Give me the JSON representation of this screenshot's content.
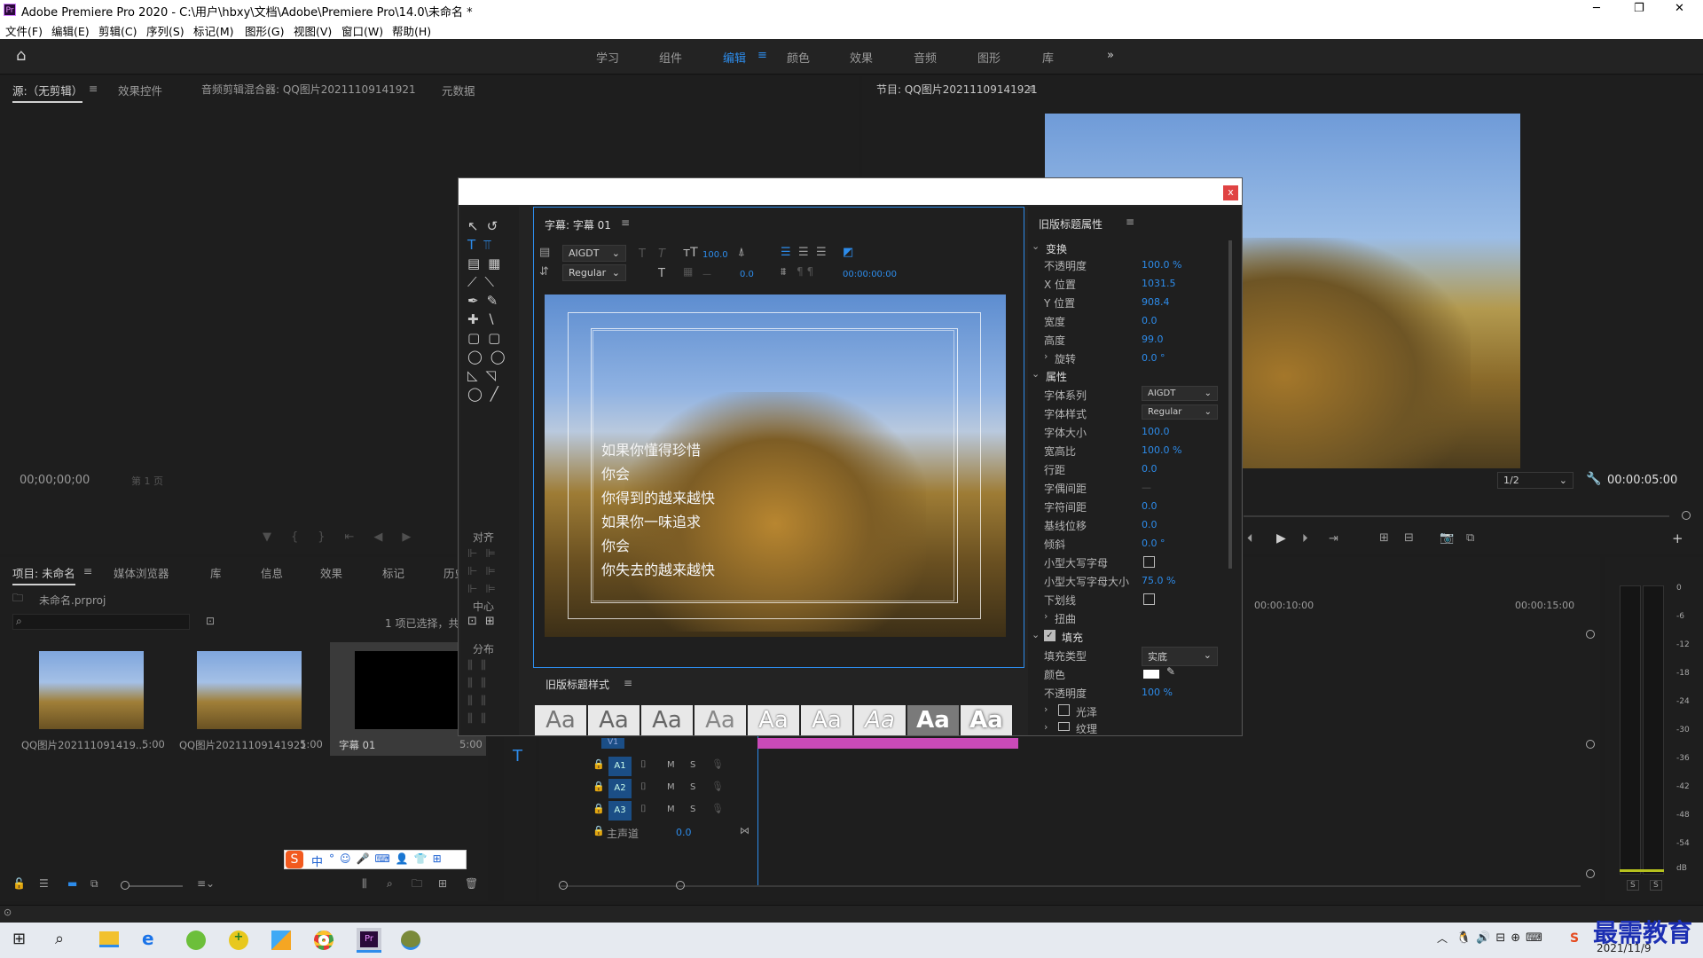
{
  "window": {
    "title": "Adobe Premiere Pro 2020 - C:\\用户\\hbxy\\文档\\Adobe\\Premiere Pro\\14.0\\未命名 *",
    "minimize": "─",
    "maximize": "❐",
    "close": "✕"
  },
  "menu": [
    "文件(F)",
    "编辑(E)",
    "剪辑(C)",
    "序列(S)",
    "标记(M)",
    "图形(G)",
    "视图(V)",
    "窗口(W)",
    "帮助(H)"
  ],
  "workspaces": [
    "学习",
    "组件",
    "编辑",
    "颜色",
    "效果",
    "音频",
    "图形",
    "库"
  ],
  "workspace_active": "编辑",
  "source_tabs": [
    "源:（无剪辑）",
    "效果控件",
    "音频剪辑混合器: QQ图片20211109141921",
    "元数据"
  ],
  "source_timecode": "00;00;00;00",
  "source_page": "第 1 页",
  "program": {
    "tab": "节目: QQ图片20211109141921",
    "zoom": "1/2",
    "timecode": "00:00:05:00"
  },
  "project": {
    "tabs": [
      "项目: 未命名",
      "媒体浏览器",
      "库",
      "信息",
      "效果",
      "标记",
      "历史"
    ],
    "file": "未命名.prproj",
    "selection": "1 项已选择，共",
    "items": [
      {
        "name": "QQ图片202111091419...",
        "dur": "5:00"
      },
      {
        "name": "QQ图片20211109141921",
        "dur": "5:00"
      },
      {
        "name": "字幕 01",
        "dur": "5:00"
      }
    ]
  },
  "ime": {
    "label": "中"
  },
  "timeline": {
    "ruler": [
      "00:00:10:00",
      "00:00:15:00"
    ],
    "tracks": [
      {
        "name": "A1",
        "m": "M",
        "s": "S"
      },
      {
        "name": "A2",
        "m": "M",
        "s": "S"
      },
      {
        "name": "A3",
        "m": "M",
        "s": "S"
      }
    ],
    "master": "主声道",
    "master_val": "0.0",
    "v1": "V1"
  },
  "meter": {
    "scale": [
      "0",
      "-6",
      "-12",
      "-18",
      "-24",
      "-30",
      "-36",
      "-42",
      "-48",
      "-54",
      "dB"
    ],
    "solo": [
      "S",
      "S"
    ]
  },
  "title_dialog": {
    "close": "x",
    "panel_title": "字幕: 字幕 01",
    "font": "AIGDT",
    "style": "Regular",
    "size": "100.0",
    "kerning": "0.0",
    "timecode": "00:00:00:00",
    "align_label": "对齐",
    "center_label": "中心",
    "distribute_label": "分布",
    "text_lines": [
      "如果你懂得珍惜",
      "你会",
      "你得到的越来越快",
      "如果你一味追求",
      "你会",
      "你失去的越来越快"
    ],
    "styles_title": "旧版标题样式",
    "style_samples": [
      "Aa",
      "Aa",
      "Aa",
      "Aa",
      "Aa",
      "Aa",
      "Aa",
      "Aa",
      "Aa"
    ],
    "props_title": "旧版标题属性",
    "transform_label": "变换",
    "transform": [
      {
        "label": "不透明度",
        "value": "100.0 %"
      },
      {
        "label": "X 位置",
        "value": "1031.5"
      },
      {
        "label": "Y 位置",
        "value": "908.4"
      },
      {
        "label": "宽度",
        "value": "0.0"
      },
      {
        "label": "高度",
        "value": "99.0"
      },
      {
        "label": "旋转",
        "value": "0.0 °"
      }
    ],
    "attrs_label": "属性",
    "attrs": [
      {
        "label": "字体系列",
        "value": "AIGDT"
      },
      {
        "label": "字体样式",
        "value": "Regular"
      },
      {
        "label": "字体大小",
        "value": "100.0"
      },
      {
        "label": "宽高比",
        "value": "100.0 %"
      },
      {
        "label": "行距",
        "value": "0.0"
      },
      {
        "label": "字偶间距",
        "value": "—"
      },
      {
        "label": "字符间距",
        "value": "0.0"
      },
      {
        "label": "基线位移",
        "value": "0.0"
      },
      {
        "label": "倾斜",
        "value": "0.0 °"
      },
      {
        "label": "小型大写字母",
        "value": ""
      },
      {
        "label": "小型大写字母大小",
        "value": "75.0 %"
      },
      {
        "label": "下划线",
        "value": ""
      },
      {
        "label": "扭曲",
        "value": ""
      }
    ],
    "fill_label": "填充",
    "fill": [
      {
        "label": "填充类型",
        "value": "实底"
      },
      {
        "label": "颜色",
        "value": ""
      },
      {
        "label": "不透明度",
        "value": "100 %"
      }
    ],
    "sheen_label": "光泽",
    "texture_label": "纹理"
  },
  "taskbar": {
    "date": "2021/11/9",
    "watermark": "最需教育"
  },
  "colors": {
    "accent": "#2d8ceb",
    "panel": "#1e1e1e",
    "dialog": "#232323",
    "pink": "#c94ab8"
  }
}
